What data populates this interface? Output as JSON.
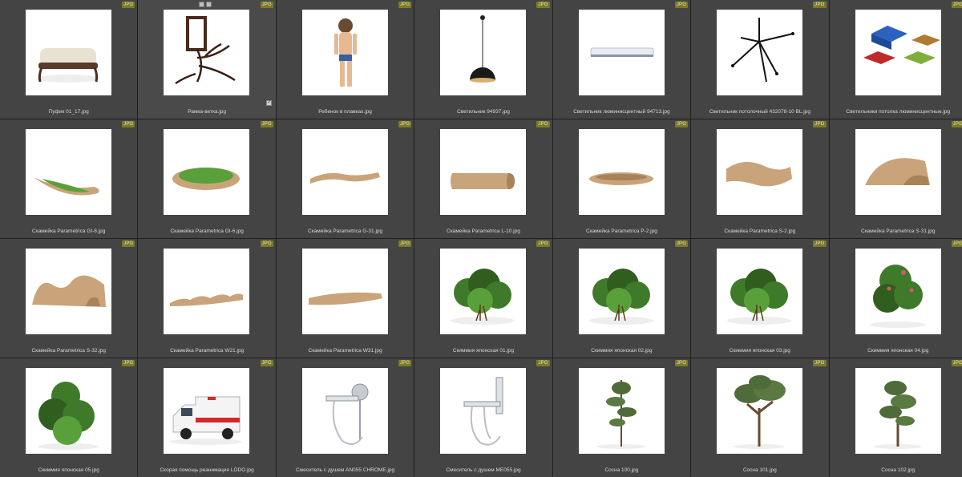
{
  "badge_label": "JPG",
  "items": [
    {
      "name": "Пуфик 01_17.jpg",
      "icon": "ottoman"
    },
    {
      "name": "Рамка-ветка.jpg",
      "icon": "branch-frame"
    },
    {
      "name": "Ребенок в плавках.jpg",
      "icon": "child"
    },
    {
      "name": "Светильник 94937.jpg",
      "icon": "pendant-lamp"
    },
    {
      "name": "Светильник люминисцентный 94713.jpg",
      "icon": "tube-lamp"
    },
    {
      "name": "Светильник потолочный 432078-10 BL.jpg",
      "icon": "chandelier"
    },
    {
      "name": "Светильники потолка люминисцентные.jpg",
      "icon": "ceiling-panels"
    },
    {
      "name": "Скамейка Parametrica GI-8.jpg",
      "icon": "bench-boat-grass"
    },
    {
      "name": "Скамейка Parametrica GI-6.jpg",
      "icon": "bench-round-grass"
    },
    {
      "name": "Скамейка Parametrica G-31.jpg",
      "icon": "bench-flat"
    },
    {
      "name": "Скамейка Parametrica L-10.jpg",
      "icon": "bench-block"
    },
    {
      "name": "Скамейка Parametrica P-2.jpg",
      "icon": "bench-dish"
    },
    {
      "name": "Скамейка Parametrica S-2.jpg",
      "icon": "bench-wave"
    },
    {
      "name": "Скамейка Parametrica S-31.jpg",
      "icon": "bench-shell"
    },
    {
      "name": "Скамейка Parametrica S-32.jpg",
      "icon": "bench-waves-tall"
    },
    {
      "name": "Скамейка Parametrica W21.jpg",
      "icon": "bench-long-wave"
    },
    {
      "name": "Скамейка Parametrica W31.jpg",
      "icon": "bench-long-flat"
    },
    {
      "name": "Скиммия японская 01.jpg",
      "icon": "shrub"
    },
    {
      "name": "Скиммия японская 02.jpg",
      "icon": "shrub"
    },
    {
      "name": "Скиммия японская 03.jpg",
      "icon": "shrub"
    },
    {
      "name": "Скиммия японская 04.jpg",
      "icon": "shrub-flower"
    },
    {
      "name": "Скиммия японская 05.jpg",
      "icon": "shrub-tall"
    },
    {
      "name": "Скорая помощь реанимация LODO.jpg",
      "icon": "ambulance"
    },
    {
      "name": "Смеситель с душем AN055 CHROME.jpg",
      "icon": "shower-mixer"
    },
    {
      "name": "Смеситель с душем ME055.jpg",
      "icon": "shower-mixer-2"
    },
    {
      "name": "Сосна 100.jpg",
      "icon": "pine-thin"
    },
    {
      "name": "Сосна 101.jpg",
      "icon": "pine-wide"
    },
    {
      "name": "Сосна 102.jpg",
      "icon": "pine-tall"
    }
  ]
}
